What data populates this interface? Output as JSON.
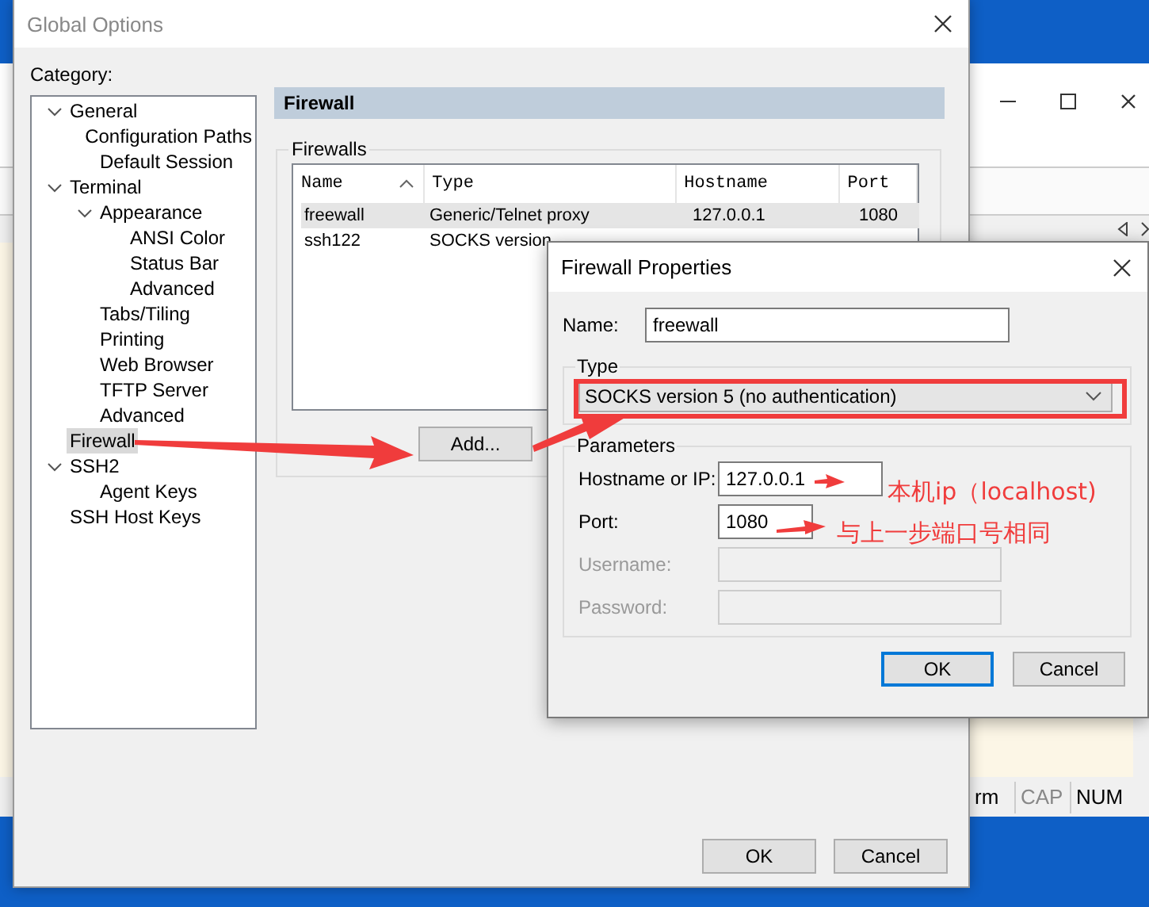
{
  "background_window": {
    "status_bar": [
      {
        "text": "rm",
        "disabled": false
      },
      {
        "text": "CAP",
        "disabled": true
      },
      {
        "text": "NUM",
        "disabled": false
      }
    ]
  },
  "global_options": {
    "title": "Global Options",
    "category_label": "Category:",
    "tree": [
      {
        "label": "General",
        "expanded": true,
        "selected": false,
        "children": [
          {
            "label": "Configuration Paths",
            "selected": false
          },
          {
            "label": "Default Session",
            "selected": false
          }
        ]
      },
      {
        "label": "Terminal",
        "expanded": true,
        "selected": false,
        "children": [
          {
            "label": "Appearance",
            "expanded": true,
            "selected": false,
            "children": [
              {
                "label": "ANSI Color",
                "selected": false
              },
              {
                "label": "Status Bar",
                "selected": false
              },
              {
                "label": "Advanced",
                "selected": false
              }
            ]
          },
          {
            "label": "Tabs/Tiling",
            "selected": false
          },
          {
            "label": "Printing",
            "selected": false
          },
          {
            "label": "Web Browser",
            "selected": false
          },
          {
            "label": "TFTP Server",
            "selected": false
          },
          {
            "label": "Advanced",
            "selected": false
          }
        ]
      },
      {
        "label": "Firewall",
        "selected": true
      },
      {
        "label": "SSH2",
        "expanded": true,
        "selected": false,
        "children": [
          {
            "label": "Agent Keys",
            "selected": false
          }
        ]
      },
      {
        "label": "SSH Host Keys",
        "selected": false
      }
    ],
    "panel_title": "Firewall",
    "group_label": "Firewalls",
    "table": {
      "columns": [
        {
          "label": "Name",
          "sorted": true
        },
        {
          "label": "Type",
          "sorted": false
        },
        {
          "label": "Hostname",
          "sorted": false
        },
        {
          "label": "Port",
          "sorted": false
        }
      ],
      "rows": [
        {
          "cells": [
            "freewall",
            "Generic/Telnet proxy",
            "127.0.0.1",
            "1080"
          ],
          "selected": true
        },
        {
          "cells": [
            "ssh122",
            "SOCKS version"
          ],
          "selected": false
        }
      ]
    },
    "add_button": "Add...",
    "buttons": [
      {
        "label": "OK"
      },
      {
        "label": "Cancel"
      }
    ]
  },
  "firewall_properties": {
    "title": "Firewall Properties",
    "name_label": "Name:",
    "name_value": "freewall",
    "type_group": "Type",
    "type_value": "SOCKS version 5 (no authentication)",
    "params_group": "Parameters",
    "fields": [
      {
        "label": "Hostname or IP:",
        "value": "127.0.0.1",
        "disabled": false
      },
      {
        "label": "Port:",
        "value": "1080",
        "disabled": false
      },
      {
        "label": "Username:",
        "disabled": true
      },
      {
        "label": "Password:",
        "disabled": true
      }
    ],
    "buttons": [
      {
        "label": "OK",
        "default": true
      },
      {
        "label": "Cancel",
        "default": false
      }
    ]
  },
  "annotations": [
    {
      "text": "本机ip（localhost)"
    },
    {
      "text": "与上一步端口号相同"
    }
  ]
}
